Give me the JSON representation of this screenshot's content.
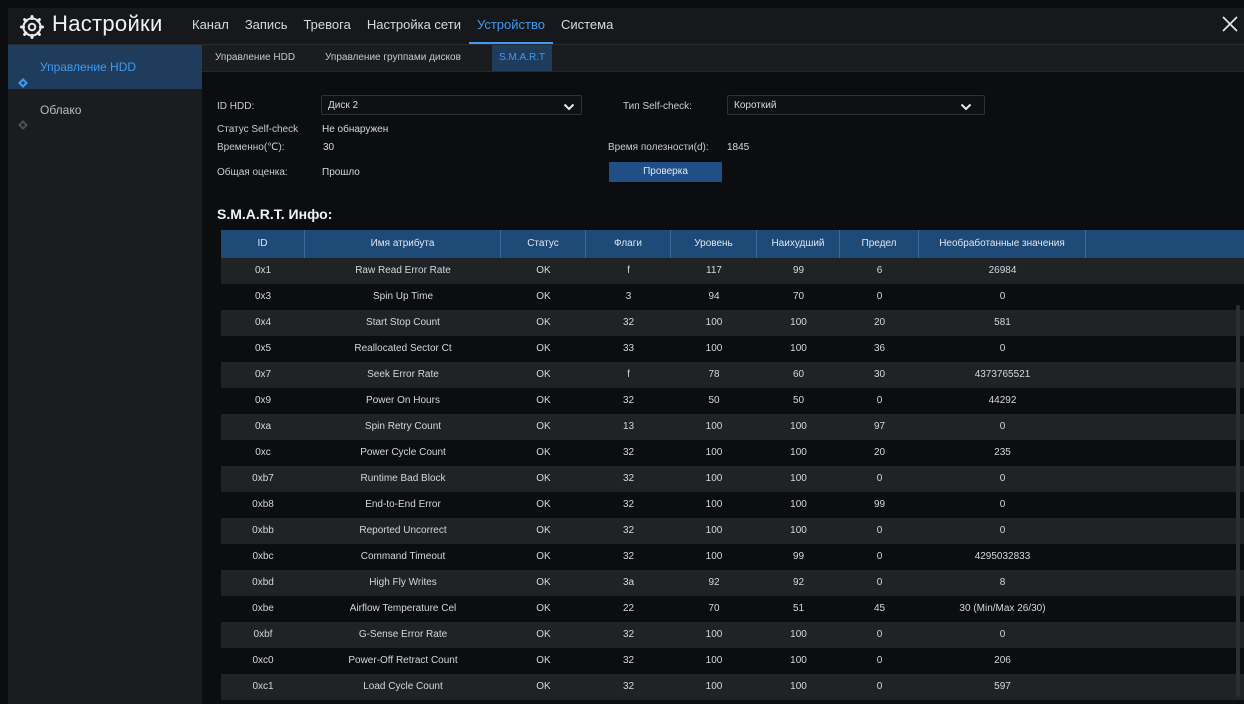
{
  "app": {
    "title": "Настройки",
    "icon": "gear-icon"
  },
  "nav": [
    "Канал",
    "Запись",
    "Тревога",
    "Настройка сети",
    "Устройство",
    "Система"
  ],
  "nav_active": "Устройство",
  "sidebar": [
    {
      "label": "Управление HDD",
      "active": true
    },
    {
      "label": "Облако",
      "active": false
    }
  ],
  "subtabs": [
    "Управление HDD",
    "Управление группами дисков",
    "S.M.A.R.T"
  ],
  "subtab_active": "S.M.A.R.T",
  "form": {
    "hdd_id_label": "ID HDD:",
    "hdd_id_value": "Диск 2",
    "selfcheck_type_label": "Тип Self-check:",
    "selfcheck_type_value": "Короткий",
    "selfcheck_status_label": "Статус Self-check",
    "selfcheck_status_value": "Не обнаружен",
    "temp_label": "Временно(℃):",
    "temp_value": "30",
    "uptime_label": "Время полезности(d):",
    "uptime_value": "1845",
    "overall_label": "Общая оценка:",
    "overall_value": "Прошло",
    "check_button": "Проверка"
  },
  "smart": {
    "title": "S.M.A.R.T. Инфо:",
    "columns": [
      "ID",
      "Имя атрибута",
      "Статус",
      "Флаги",
      "Уровень",
      "Наихудший",
      "Предел",
      "Необработанные значения",
      ""
    ],
    "rows": [
      [
        "0x1",
        "Raw Read Error Rate",
        "OK",
        "f",
        "117",
        "99",
        "6",
        "26984"
      ],
      [
        "0x3",
        "Spin Up Time",
        "OK",
        "3",
        "94",
        "70",
        "0",
        "0"
      ],
      [
        "0x4",
        "Start Stop Count",
        "OK",
        "32",
        "100",
        "100",
        "20",
        "581"
      ],
      [
        "0x5",
        "Reallocated Sector Ct",
        "OK",
        "33",
        "100",
        "100",
        "36",
        "0"
      ],
      [
        "0x7",
        "Seek Error Rate",
        "OK",
        "f",
        "78",
        "60",
        "30",
        "4373765521"
      ],
      [
        "0x9",
        "Power On Hours",
        "OK",
        "32",
        "50",
        "50",
        "0",
        "44292"
      ],
      [
        "0xa",
        "Spin Retry Count",
        "OK",
        "13",
        "100",
        "100",
        "97",
        "0"
      ],
      [
        "0xc",
        "Power Cycle Count",
        "OK",
        "32",
        "100",
        "100",
        "20",
        "235"
      ],
      [
        "0xb7",
        "Runtime Bad Block",
        "OK",
        "32",
        "100",
        "100",
        "0",
        "0"
      ],
      [
        "0xb8",
        "End-to-End Error",
        "OK",
        "32",
        "100",
        "100",
        "99",
        "0"
      ],
      [
        "0xbb",
        "Reported Uncorrect",
        "OK",
        "32",
        "100",
        "100",
        "0",
        "0"
      ],
      [
        "0xbc",
        "Command Timeout",
        "OK",
        "32",
        "100",
        "99",
        "0",
        "4295032833"
      ],
      [
        "0xbd",
        "High Fly Writes",
        "OK",
        "3a",
        "92",
        "92",
        "0",
        "8"
      ],
      [
        "0xbe",
        "Airflow Temperature Cel",
        "OK",
        "22",
        "70",
        "51",
        "45",
        "30 (Min/Max 26/30)"
      ],
      [
        "0xbf",
        "G-Sense Error Rate",
        "OK",
        "32",
        "100",
        "100",
        "0",
        "0"
      ],
      [
        "0xc0",
        "Power-Off Retract Count",
        "OK",
        "32",
        "100",
        "100",
        "0",
        "206"
      ],
      [
        "0xc1",
        "Load Cycle Count",
        "OK",
        "32",
        "100",
        "100",
        "0",
        "597"
      ]
    ]
  },
  "colors": {
    "accent": "#3f9af0",
    "header_bg": "#1e4a78",
    "active_bg": "#1f3c5d",
    "button_bg": "#1f4f86"
  }
}
